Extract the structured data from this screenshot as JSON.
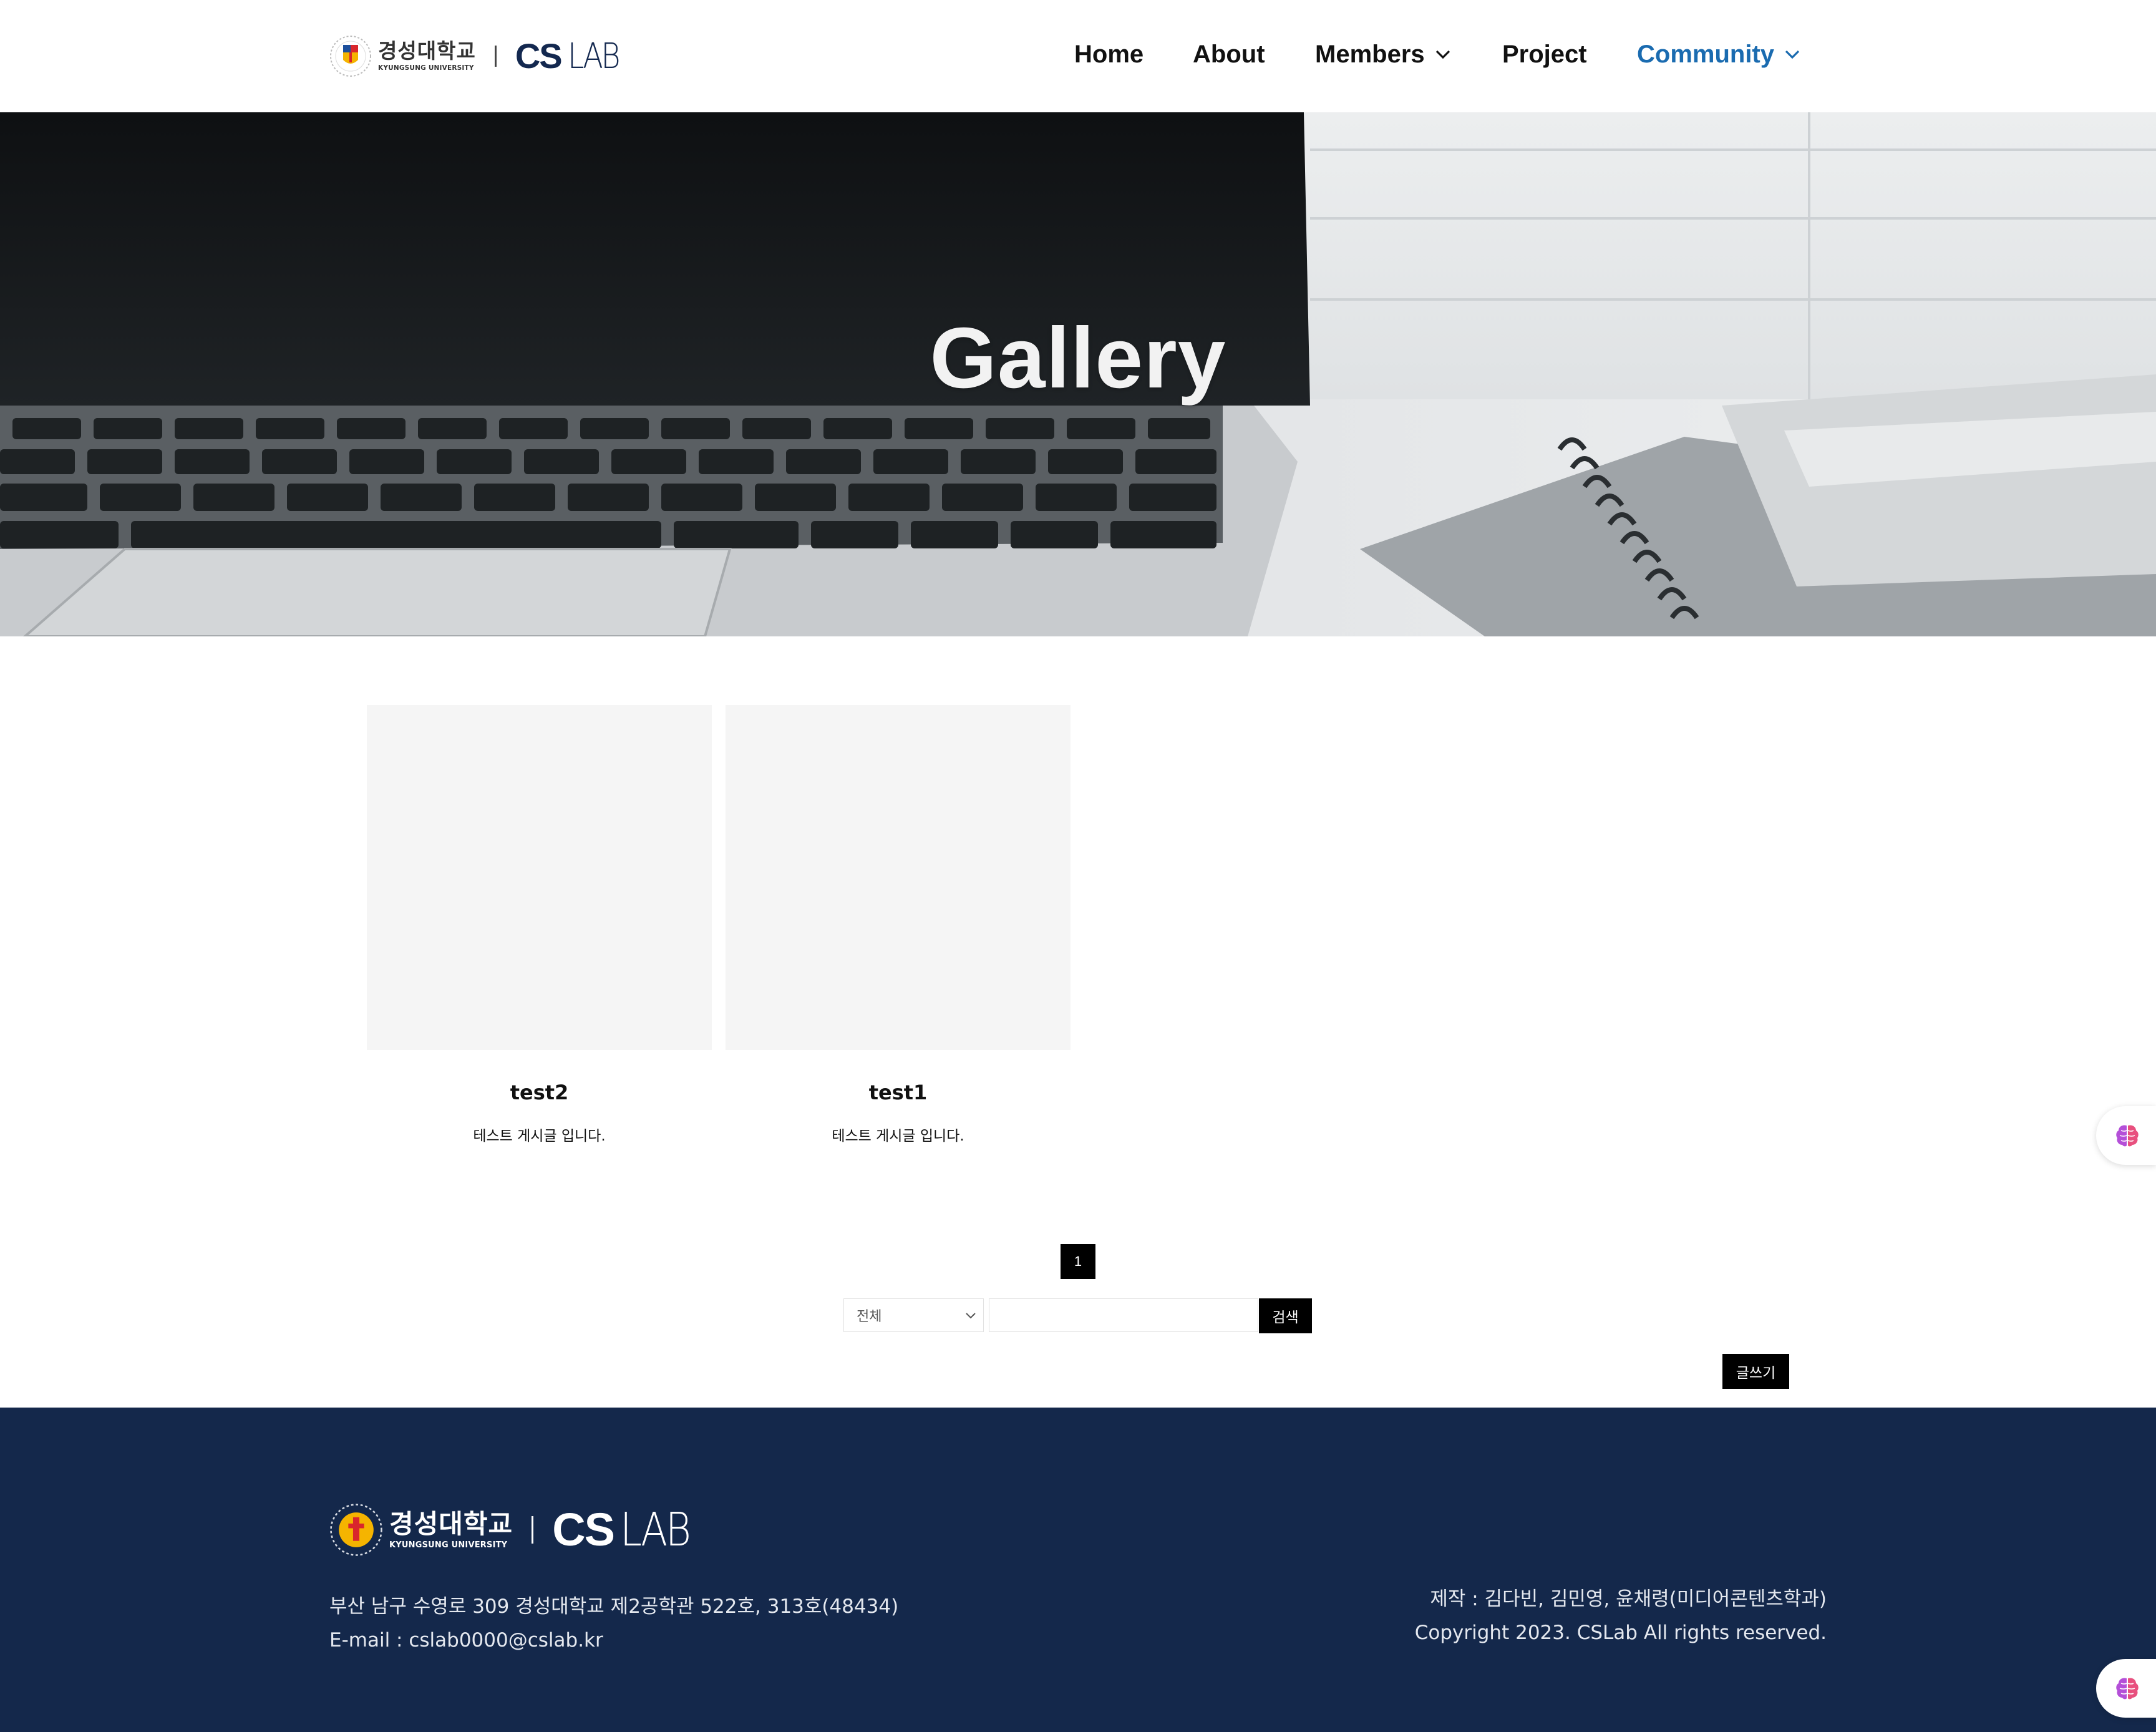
{
  "header": {
    "logo": {
      "university_ko": "경성대학교",
      "university_en": "KYUNGSUNG UNIVERSITY",
      "lab_cs": "CS",
      "lab_rest": "LAB"
    },
    "nav": [
      {
        "label": "Home",
        "has_dropdown": false,
        "active": false
      },
      {
        "label": "About",
        "has_dropdown": false,
        "active": false
      },
      {
        "label": "Members",
        "has_dropdown": true,
        "active": false
      },
      {
        "label": "Project",
        "has_dropdown": false,
        "active": false
      },
      {
        "label": "Community",
        "has_dropdown": true,
        "active": true
      }
    ],
    "active_color": "#1a6bb0"
  },
  "hero": {
    "title": "Gallery"
  },
  "gallery": {
    "posts": [
      {
        "title": "test2",
        "description": "테스트 게시글 입니다."
      },
      {
        "title": "test1",
        "description": "테스트 게시글 입니다."
      }
    ]
  },
  "pagination": {
    "current_page": "1"
  },
  "search": {
    "scope_selected": "전체",
    "query_value": "",
    "button_label": "검색"
  },
  "write_button": {
    "label": "글쓰기"
  },
  "footer": {
    "logo": {
      "university_ko": "경성대학교",
      "university_en": "KYUNGSUNG UNIVERSITY",
      "lab_cs": "CS",
      "lab_rest": "LAB"
    },
    "address": "부산 남구 수영로 309 경성대학교 제2공학관 522호, 313호(48434)",
    "email": "E-mail : cslab0000@cslab.kr",
    "credits": "제작 : 김다빈, 김민영, 윤채령(미디어콘텐츠학과)",
    "copyright": "Copyright 2023. CSLab All rights reserved.",
    "background_color": "#14284b"
  },
  "icons": {
    "floating_widget": "brain-icon",
    "dropdown": "chevron-down-icon"
  }
}
